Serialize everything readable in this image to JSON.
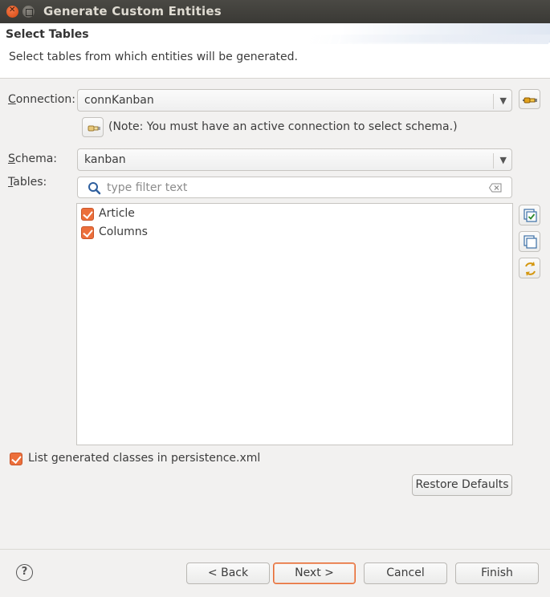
{
  "window": {
    "title": "Generate Custom Entities"
  },
  "banner": {
    "title": "Select Tables",
    "description": "Select tables from which entities will be generated."
  },
  "connection": {
    "label_prefix": "C",
    "label_rest": "onnection:",
    "value": "connKanban",
    "note": "(Note: You must have an active connection to select schema.)"
  },
  "schema": {
    "label_prefix": "S",
    "label_rest": "chema:",
    "value": "kanban"
  },
  "tables": {
    "label_prefix": "T",
    "label_rest": "ables:",
    "filter_placeholder": "type filter text",
    "items": [
      {
        "label": "Article",
        "checked": true
      },
      {
        "label": "Columns",
        "checked": true
      }
    ]
  },
  "options": {
    "list_generated_label": "List generated classes in persistence.xml",
    "list_generated_checked": true
  },
  "buttons": {
    "restore_defaults": "Restore Defaults",
    "back": "< Back",
    "next": "Next >",
    "cancel": "Cancel",
    "finish": "Finish",
    "help": "?"
  },
  "colors": {
    "accent": "#ec6f3b",
    "titlebar": "#3e3d39",
    "background": "#f2f1f0"
  }
}
